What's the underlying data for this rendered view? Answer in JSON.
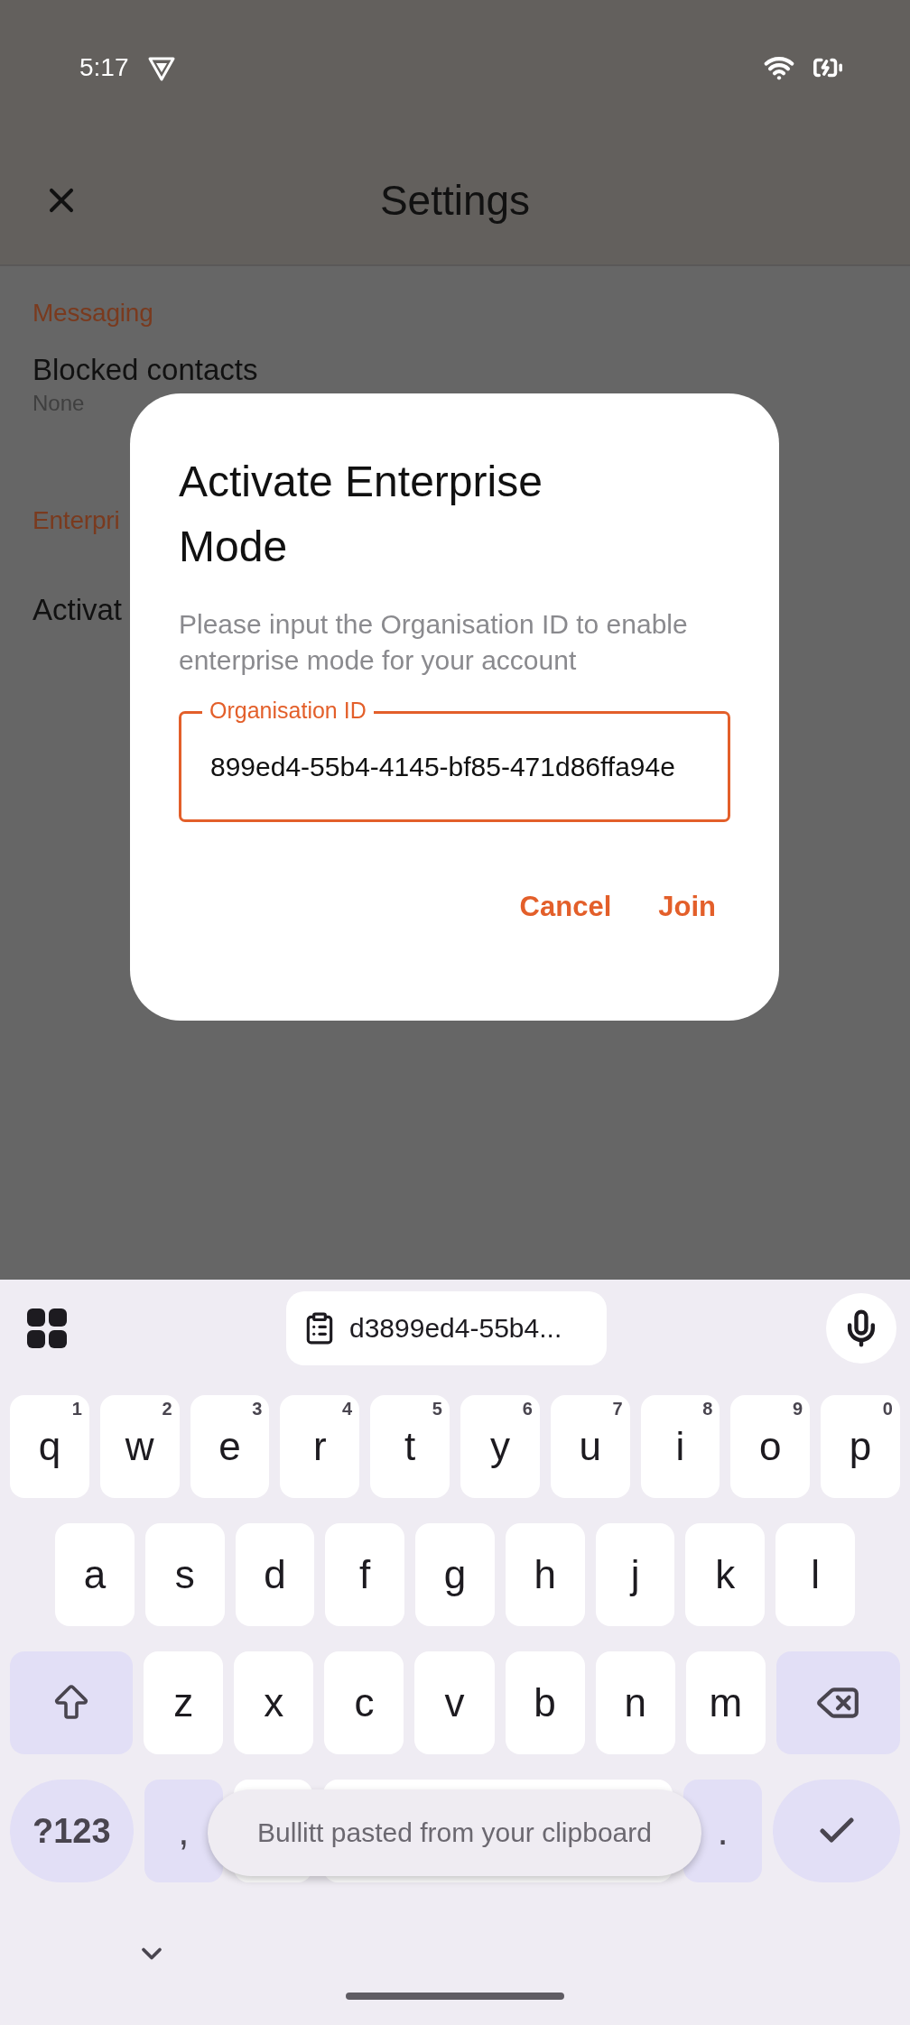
{
  "status_bar": {
    "time": "5:17"
  },
  "app_bar": {
    "title": "Settings"
  },
  "settings": [
    {
      "header": "Messaging",
      "items": [
        {
          "title": "Blocked contacts",
          "subtitle": "None"
        }
      ]
    },
    {
      "header": "Enterpri",
      "items": [
        {
          "title": "Activat"
        }
      ]
    }
  ],
  "dialog": {
    "title": "Activate Enterprise Mode",
    "message": "Please input the Organisation ID to enable enterprise mode for your account",
    "field": {
      "label": "Organisation ID",
      "value": "899ed4-55b4-4145-bf85-471d86ffa94e"
    },
    "buttons": [
      "Cancel",
      "Join"
    ]
  },
  "keyboard": {
    "clipboard_chip": "d3899ed4-55b4...",
    "rows": [
      {
        "keys": [
          {
            "kind": "letter",
            "label": "q",
            "hint": "1"
          },
          {
            "kind": "letter",
            "label": "w",
            "hint": "2"
          },
          {
            "kind": "letter",
            "label": "e",
            "hint": "3"
          },
          {
            "kind": "letter",
            "label": "r",
            "hint": "4"
          },
          {
            "kind": "letter",
            "label": "t",
            "hint": "5"
          },
          {
            "kind": "letter",
            "label": "y",
            "hint": "6"
          },
          {
            "kind": "letter",
            "label": "u",
            "hint": "7"
          },
          {
            "kind": "letter",
            "label": "i",
            "hint": "8"
          },
          {
            "kind": "letter",
            "label": "o",
            "hint": "9"
          },
          {
            "kind": "letter",
            "label": "p",
            "hint": "0"
          }
        ]
      },
      {
        "keys": [
          {
            "kind": "letter",
            "label": "a"
          },
          {
            "kind": "letter",
            "label": "s"
          },
          {
            "kind": "letter",
            "label": "d"
          },
          {
            "kind": "letter",
            "label": "f"
          },
          {
            "kind": "letter",
            "label": "g"
          },
          {
            "kind": "letter",
            "label": "h"
          },
          {
            "kind": "letter",
            "label": "j"
          },
          {
            "kind": "letter",
            "label": "k"
          },
          {
            "kind": "letter",
            "label": "l"
          }
        ]
      },
      {
        "keys": [
          {
            "kind": "shift"
          },
          {
            "kind": "letter",
            "label": "z"
          },
          {
            "kind": "letter",
            "label": "x"
          },
          {
            "kind": "letter",
            "label": "c"
          },
          {
            "kind": "letter",
            "label": "v"
          },
          {
            "kind": "letter",
            "label": "b"
          },
          {
            "kind": "letter",
            "label": "n"
          },
          {
            "kind": "letter",
            "label": "m"
          },
          {
            "kind": "backspace"
          }
        ]
      },
      {
        "keys": [
          {
            "kind": "symbols",
            "label": "?123"
          },
          {
            "kind": "punct",
            "label": ","
          },
          {
            "kind": "blank"
          },
          {
            "kind": "space"
          },
          {
            "kind": "punct",
            "label": "."
          },
          {
            "kind": "enter"
          }
        ]
      }
    ],
    "toast": "Bullitt pasted from your clipboard"
  }
}
